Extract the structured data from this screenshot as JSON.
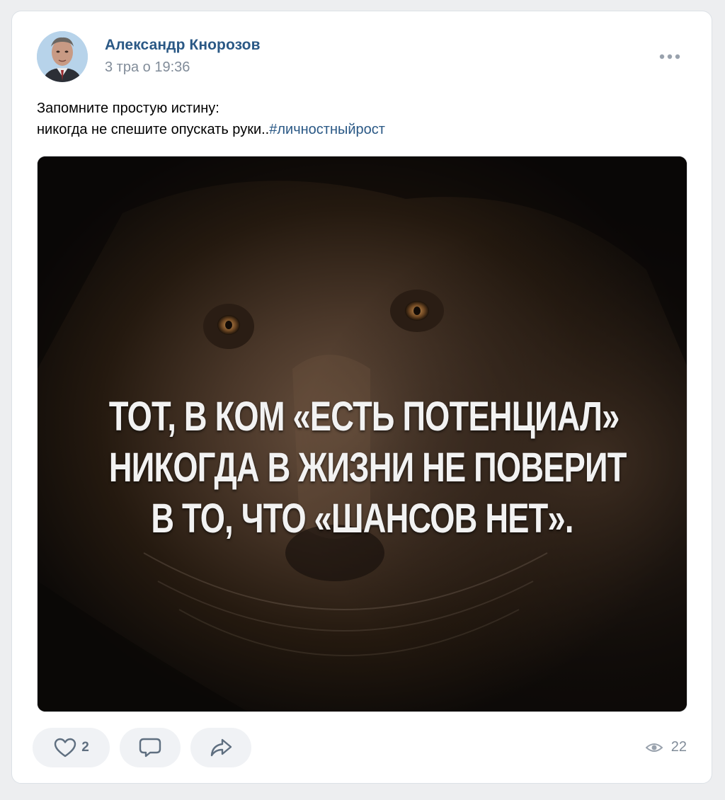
{
  "post": {
    "author": "Александр Кнорозов",
    "date": "3 тра о 19:36",
    "text_line1": "Запомните простую истину:",
    "text_line2": "никогда не спешите опускать руки..",
    "hashtag": "#личностныйрост",
    "image_quote": {
      "line1": "ТОТ, В КОМ «ЕСТЬ ПОТЕНЦИАЛ»",
      "line2": "НИКОГДА В ЖИЗНИ НЕ ПОВЕРИТ",
      "line3": "В ТО, ЧТО «ШАНСОВ НЕТ»."
    }
  },
  "actions": {
    "likes": "2",
    "views": "22"
  },
  "icons": {
    "more": "more-horizontal-icon",
    "like": "heart-icon",
    "comment": "comment-icon",
    "share": "share-icon",
    "views": "eye-icon"
  },
  "colors": {
    "link": "#2a5885",
    "secondary": "#818c99",
    "button_bg": "#f0f2f5",
    "icon": "#5f6f80"
  }
}
